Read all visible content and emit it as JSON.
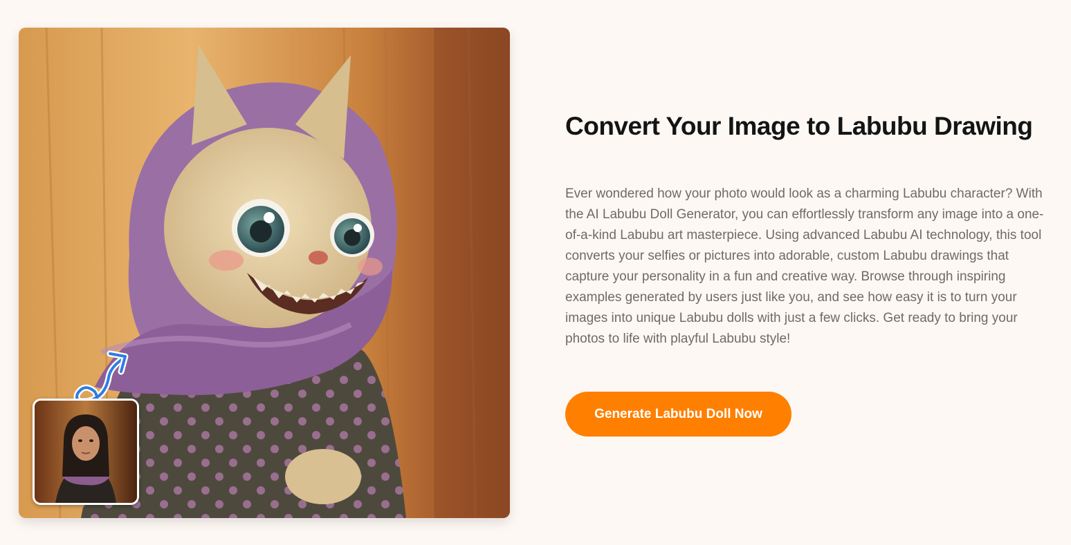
{
  "hero": {
    "title": "Convert Your Image to Labubu Drawing",
    "description": "Ever wondered how your photo would look as a charming Labubu character? With the AI Labubu Doll Generator, you can effortlessly transform any image into a one-of-a-kind Labubu art masterpiece. Using advanced Labubu AI technology, this tool converts your selfies or pictures into adorable, custom Labubu drawings that capture your personality in a fun and creative way. Browse through inspiring examples generated by users just like you, and see how easy it is to turn your images into unique Labubu dolls with just a few clicks. Get ready to bring your photos to life with playful Labubu style!",
    "cta_label": "Generate Labubu Doll Now"
  },
  "showcase": {
    "result_image": "labubu-drawing-in-purple-scarf",
    "source_image": "woman-portrait-in-purple-scarf",
    "transform_icon": "curly-arrow-icon"
  },
  "colors": {
    "background": "#fdf8f4",
    "accent": "#ff7f00",
    "title": "#141414",
    "body_text": "#6f6a66",
    "arrow": "#2f7de1"
  }
}
